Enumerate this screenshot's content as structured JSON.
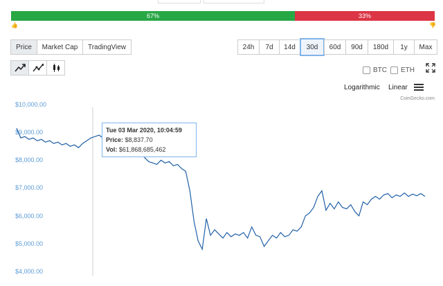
{
  "sentiment": {
    "up_label": "67%",
    "down_label": "33%",
    "up_fraction": 0.67,
    "up_color": "#28a745",
    "down_color": "#dc3545"
  },
  "chart_tabs": [
    "Price",
    "Market Cap",
    "TradingView"
  ],
  "active_chart_tab": "Price",
  "range_buttons": [
    "24h",
    "7d",
    "14d",
    "30d",
    "60d",
    "90d",
    "180d",
    "1y",
    "Max"
  ],
  "active_range": "30d",
  "chart_styles": [
    "line-chart-icon",
    "ohlc-line-icon",
    "candlestick-icon"
  ],
  "compare": {
    "btc_label": "BTC",
    "eth_label": "ETH"
  },
  "scale": {
    "log_label": "Logarithmic",
    "linear_label": "Linear"
  },
  "credit": "CoinGecko.com",
  "tooltip": {
    "date": "Tue 03 Mar 2020, 10:04:59",
    "price_label": "Price:",
    "price_value": "$8,837.70",
    "vol_label": "Vol:",
    "vol_value": "$61,868,685,462"
  },
  "accent_color": "#1f5fa6",
  "chart_data": {
    "type": "line",
    "title": "",
    "xlabel": "",
    "ylabel": "",
    "ylim": [
      4000,
      10000
    ],
    "yticks": [
      "$10,000.00",
      "$9,000.00",
      "$8,000.00",
      "$7,000.00",
      "$6,000.00",
      "$5,000.00",
      "$4,000.00"
    ],
    "series": [
      {
        "values": [
          9150,
          8800,
          8850,
          8750,
          8800,
          8700,
          8750,
          8650,
          8700,
          8600,
          8650,
          8550,
          8600,
          8500,
          8550,
          8450,
          8600,
          8700,
          8800,
          8850,
          8900,
          8800,
          8700,
          8600,
          8650,
          8550,
          8500,
          8450,
          8400,
          8350,
          8300,
          8100,
          7950,
          7900,
          7850,
          8000,
          7900,
          7950,
          7800,
          7850,
          7700,
          7600,
          6900,
          5800,
          5100,
          4800,
          5900,
          5300,
          5500,
          5350,
          5200,
          5400,
          5250,
          5350,
          5300,
          5400,
          5200,
          5600,
          5300,
          5250,
          4900,
          5100,
          5300,
          5200,
          5400,
          5250,
          5300,
          5500,
          5450,
          5600,
          6000,
          6100,
          6300,
          6700,
          6900,
          6200,
          6450,
          6250,
          6500,
          6300,
          6250,
          6400,
          6150,
          6000,
          6500,
          6400,
          6600,
          6700,
          6600,
          6750,
          6800,
          6650,
          6750,
          6700,
          6820,
          6700,
          6780,
          6720,
          6800,
          6700
        ]
      }
    ],
    "grid": false
  }
}
